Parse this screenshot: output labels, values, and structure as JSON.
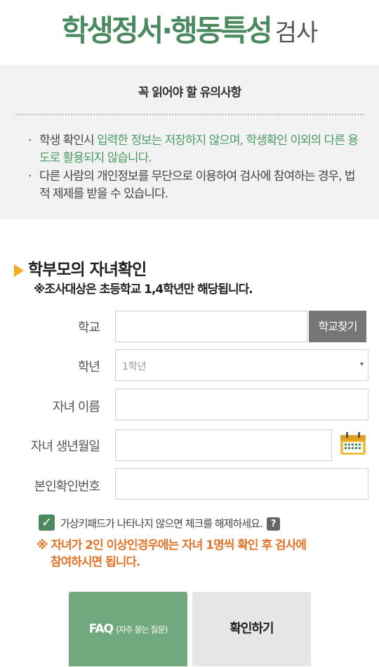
{
  "header": {
    "title_main": "학생정서·행동특성",
    "title_sub": "검사"
  },
  "notice": {
    "heading": "꼭 읽어야 할 유의사항",
    "bullet_mark": "·",
    "item1": {
      "plain": "학생 확인시 ",
      "green": "입력한 정보는 저장하지 않으며, 학생확인 이외의 다른 용도로 활용되지 않습니다."
    },
    "item2": "다른 사람의 개인정보를 무단으로 이용하여 검사에 참여하는 경우, 법적 제제를 받을 수 있습니다."
  },
  "section": {
    "title": "학부모의 자녀확인",
    "subtitle": "※조사대상은 초등학교 1,4학년만 해당됩니다."
  },
  "form": {
    "school_label": "학교",
    "school_value": "",
    "find_school_button": "학교찾기",
    "grade_label": "학년",
    "grade_selected": "1학년",
    "grade_arrow": "▾",
    "child_name_label": "자녀 이름",
    "child_name_value": "",
    "birthdate_label": "자녀 생년월일",
    "birthdate_value": "",
    "verify_label": "본인확인번호",
    "verify_value": ""
  },
  "options": {
    "checkbox_mark": "✓",
    "virtual_keypad_text": "가상키패드가 나타나지 않으면 체크를 해제하세요.",
    "help_mark": "?",
    "warning_line1": "※ 자녀가 2인 이상인경우에는 자녀 1명씩 확인 후 검사에",
    "warning_line2": "참여하시면 됩니다."
  },
  "buttons": {
    "faq_main": "FAQ",
    "faq_sub": "(자주 묻는 질문)",
    "confirm": "확인하기"
  },
  "colors": {
    "brand_green": "#4a8a5e",
    "accent_orange": "#e2752a",
    "calendar_yellow": "#f0c040"
  },
  "icons": [
    "triangle-marker-icon",
    "calendar-icon",
    "check-icon",
    "help-icon"
  ]
}
